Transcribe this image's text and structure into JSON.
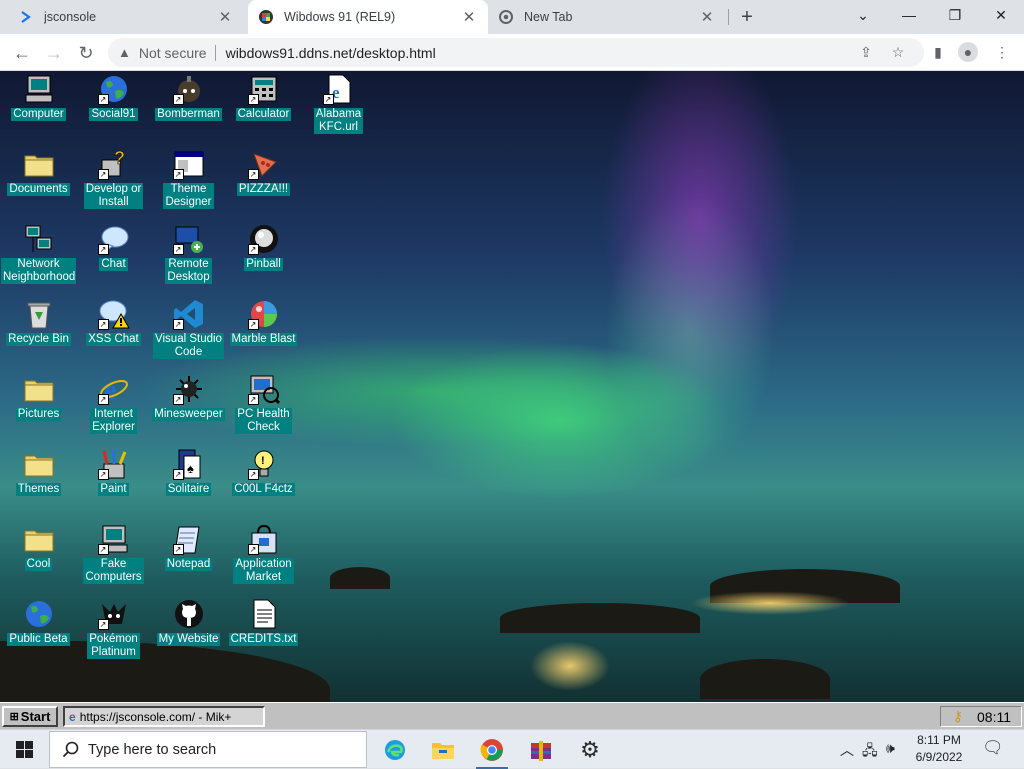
{
  "browser": {
    "tabs": [
      {
        "title": "jsconsole"
      },
      {
        "title": "Wibdows 91 (REL9)"
      },
      {
        "title": "New Tab"
      }
    ],
    "security_label": "Not secure",
    "url": "wibdows91.ddns.net/desktop.html"
  },
  "desktop": {
    "icons": [
      {
        "label": "Computer",
        "icon": "computer-icon"
      },
      {
        "label": "Social91",
        "icon": "globe-icon"
      },
      {
        "label": "Bomberman",
        "icon": "bomberman-icon"
      },
      {
        "label": "Calculator",
        "icon": "calculator-icon"
      },
      {
        "label": "Alabama\nKFC.url",
        "icon": "ie-document-icon"
      },
      {
        "label": "Documents",
        "icon": "folder-icon"
      },
      {
        "label": "Develop or\nInstall",
        "icon": "develop-icon"
      },
      {
        "label": "Theme\nDesigner",
        "icon": "window-icon"
      },
      {
        "label": "PIZZZA!!!",
        "icon": "pizza-icon"
      },
      {
        "label": "Network\nNeighborhood",
        "icon": "network-icon"
      },
      {
        "label": "Chat",
        "icon": "chat-bubble-icon"
      },
      {
        "label": "Remote\nDesktop",
        "icon": "remote-desktop-icon"
      },
      {
        "label": "Pinball",
        "icon": "pinball-icon"
      },
      {
        "label": "Recycle Bin",
        "icon": "recycle-bin-icon"
      },
      {
        "label": "XSS Chat",
        "icon": "warning-chat-icon"
      },
      {
        "label": "Visual Studio\nCode",
        "icon": "vscode-icon"
      },
      {
        "label": "Marble Blast",
        "icon": "marble-icon"
      },
      {
        "label": "Pictures",
        "icon": "folder-icon"
      },
      {
        "label": "Internet\nExplorer",
        "icon": "ie-icon"
      },
      {
        "label": "Minesweeper",
        "icon": "mine-icon"
      },
      {
        "label": "PC Health\nCheck",
        "icon": "pc-health-icon"
      },
      {
        "label": "Themes",
        "icon": "folder-icon"
      },
      {
        "label": "Paint",
        "icon": "paint-icon"
      },
      {
        "label": "Solitaire",
        "icon": "cards-icon"
      },
      {
        "label": "C00L F4ctz",
        "icon": "lightbulb-icon"
      },
      {
        "label": "Cool",
        "icon": "folder-icon"
      },
      {
        "label": "Fake\nComputers",
        "icon": "computer-icon"
      },
      {
        "label": "Notepad",
        "icon": "notepad-icon"
      },
      {
        "label": "Application\nMarket",
        "icon": "market-icon"
      },
      {
        "label": "Public Beta",
        "icon": "globe-icon"
      },
      {
        "label": "Pokémon\nPlatinum",
        "icon": "pokemon-icon"
      },
      {
        "label": "My Website",
        "icon": "github-icon"
      },
      {
        "label": "CREDITS.txt",
        "icon": "text-file-icon"
      }
    ]
  },
  "w91_taskbar": {
    "start_label": "Start",
    "task_label": "https://jsconsole.com/ - Mik+",
    "clock": "08:11"
  },
  "w10_taskbar": {
    "search_placeholder": "Type here to search",
    "time": "8:11 PM",
    "date": "6/9/2022"
  }
}
